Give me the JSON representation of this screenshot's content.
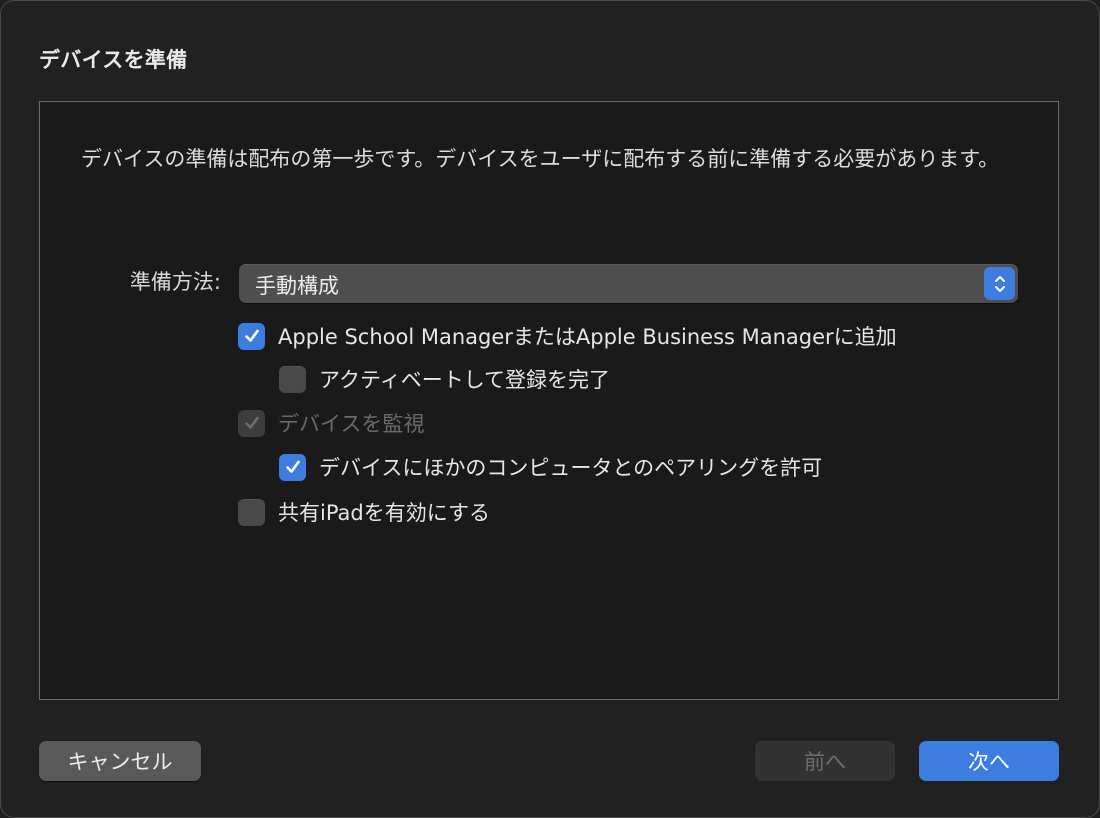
{
  "dialog": {
    "title": "デバイスを準備",
    "description": "デバイスの準備は配布の第一歩です。デバイスをユーザに配布する前に準備する必要があります。"
  },
  "method": {
    "label": "準備方法:",
    "selected_value": "手動構成"
  },
  "options": [
    {
      "label": "Apple School ManagerまたはApple Business Managerに追加",
      "checked": true,
      "enabled": true
    },
    {
      "label": "アクティベートして登録を完了",
      "checked": false,
      "enabled": true
    },
    {
      "label": "デバイスを監視",
      "checked": true,
      "enabled": false
    },
    {
      "label": "デバイスにほかのコンピュータとのペアリングを許可",
      "checked": true,
      "enabled": true
    },
    {
      "label": "共有iPadを有効にする",
      "checked": false,
      "enabled": true
    }
  ],
  "buttons": {
    "cancel": "キャンセル",
    "back": "前へ",
    "next": "次へ"
  },
  "colors": {
    "accent": "#3d7de0",
    "background": "#222122"
  }
}
